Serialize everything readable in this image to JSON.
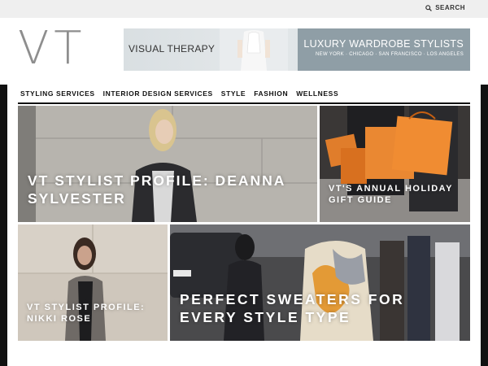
{
  "topbar": {
    "search_label": "SEARCH"
  },
  "header": {
    "logo_text": "VT",
    "banner": {
      "brand": "VISUAL THERAPY",
      "tagline": "LUXURY WARDROBE STYLISTS",
      "cities": "NEW YORK  ·  CHICAGO  ·  SAN FRANCISCO  ·  LOS ANGELES"
    }
  },
  "nav": {
    "items": [
      {
        "label": "STYLING SERVICES"
      },
      {
        "label": "INTERIOR DESIGN SERVICES"
      },
      {
        "label": "STYLE"
      },
      {
        "label": "FASHION"
      },
      {
        "label": "WELLNESS"
      }
    ]
  },
  "tiles": [
    {
      "title": "VT STYLIST PROFILE: DEANNA SYLVESTER"
    },
    {
      "title": "VT'S ANNUAL HOLIDAY GIFT GUIDE"
    },
    {
      "title": "VT STYLIST PROFILE: NIKKI ROSE"
    },
    {
      "title": "PERFECT SWEATERS FOR EVERY STYLE TYPE"
    }
  ],
  "colors": {
    "logo": "#8e8e8e",
    "banner_accent": "#8f9ea6",
    "nav_text": "#111111",
    "tile_text": "#ffffff"
  }
}
